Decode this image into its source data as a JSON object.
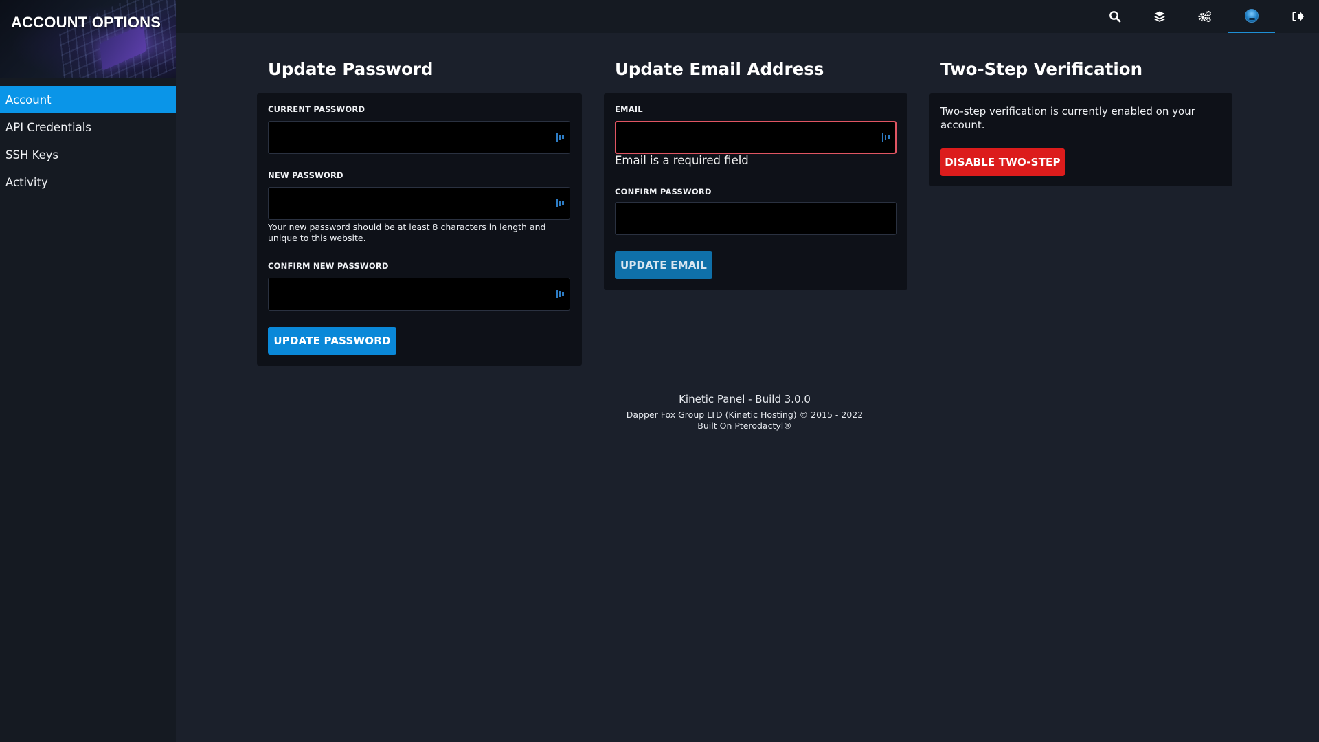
{
  "sidebar": {
    "title": "ACCOUNT OPTIONS",
    "items": [
      {
        "label": "Account",
        "active": true
      },
      {
        "label": "API Credentials",
        "active": false
      },
      {
        "label": "SSH Keys",
        "active": false
      },
      {
        "label": "Activity",
        "active": false
      }
    ]
  },
  "topbar": {
    "icons": [
      "search-icon",
      "layers-icon",
      "settings-icon",
      "avatar-icon",
      "logout-icon"
    ],
    "active_icon": "avatar-icon"
  },
  "update_password": {
    "heading": "Update Password",
    "current_label": "CURRENT PASSWORD",
    "current_value": "",
    "new_label": "NEW PASSWORD",
    "new_value": "",
    "help": "Your new password should be at least 8 characters in length and unique to this website.",
    "confirm_label": "CONFIRM NEW PASSWORD",
    "confirm_value": "",
    "button": "UPDATE PASSWORD"
  },
  "update_email": {
    "heading": "Update Email Address",
    "email_label": "EMAIL",
    "email_value": "",
    "email_error": "Email is a required field",
    "confirm_label": "CONFIRM PASSWORD",
    "confirm_value": "",
    "button": "UPDATE EMAIL"
  },
  "two_step": {
    "heading": "Two-Step Verification",
    "status_text": "Two-step verification is currently enabled on your account.",
    "button": "DISABLE TWO-STEP"
  },
  "footer": {
    "line1": "Kinetic Panel - Build 3.0.0",
    "line2": "Dapper Fox Group LTD (Kinetic Hosting) © 2015 - 2022",
    "line3": "Built On Pterodactyl®"
  },
  "colors": {
    "accent": "#0a95e8",
    "danger": "#dc1c1c",
    "error_border": "#e05562",
    "background": "#1b202b",
    "card": "#0e1118"
  }
}
